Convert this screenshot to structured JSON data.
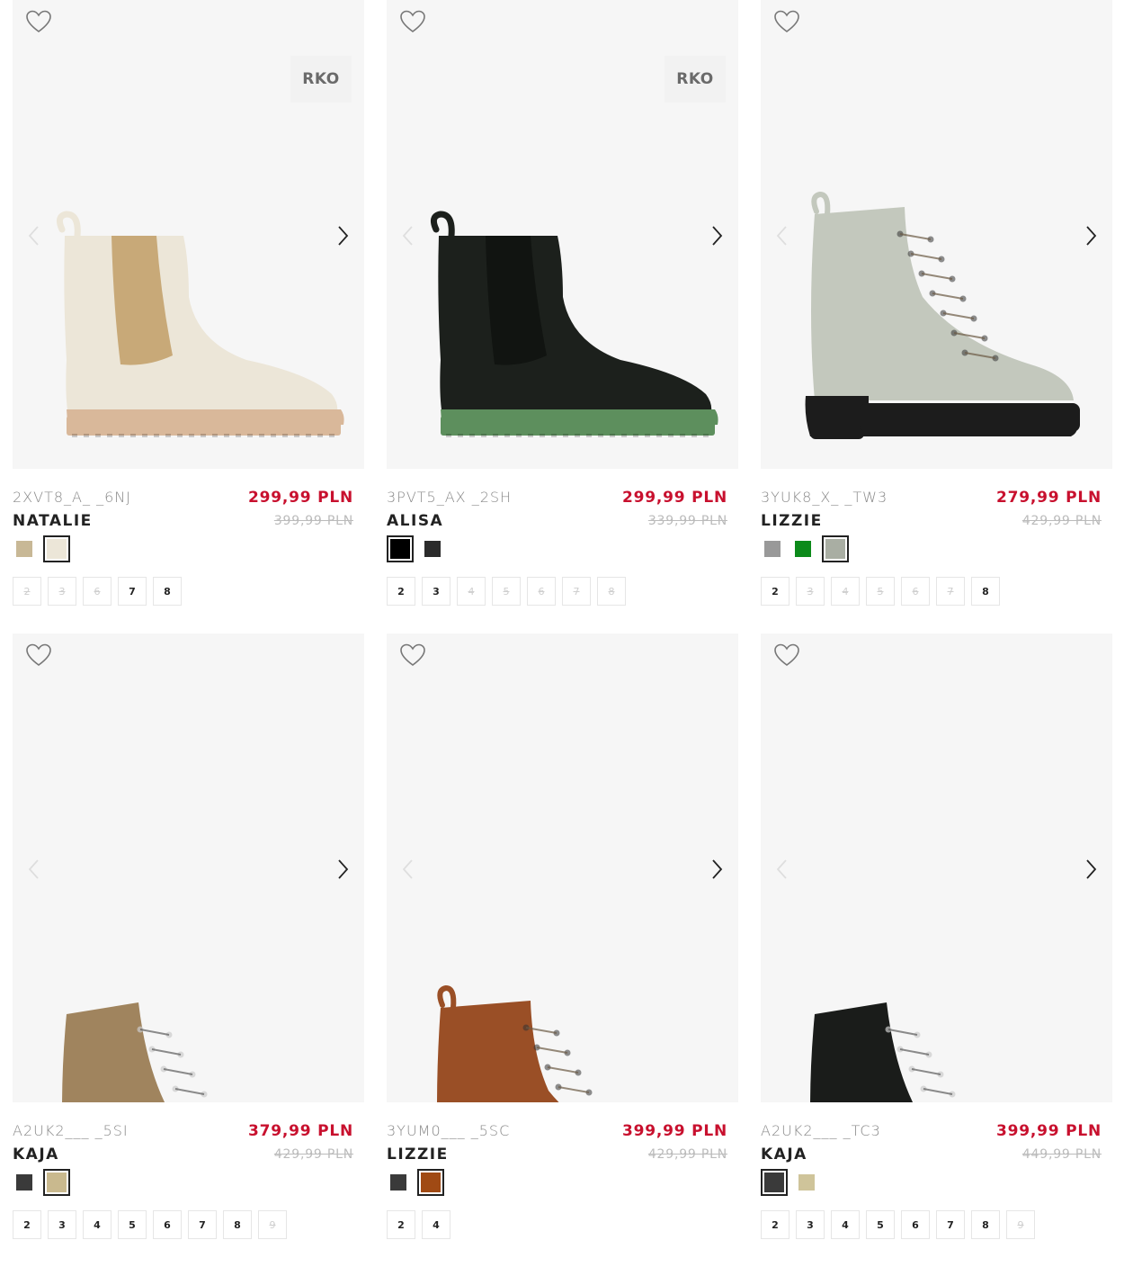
{
  "products": [
    {
      "code": "2XVT8_A_ _6NJ",
      "name": "NATALIE",
      "price": "299,99 PLN",
      "old_price": "399,99 PLN",
      "badge": "RKO",
      "colors": [
        "#c8b896",
        "#ece6d8"
      ],
      "active_color": 1,
      "sizes": [
        {
          "label": "2",
          "available": false
        },
        {
          "label": "3",
          "available": false
        },
        {
          "label": "6",
          "available": false
        },
        {
          "label": "7",
          "available": true
        },
        {
          "label": "8",
          "available": true
        }
      ],
      "boot": {
        "style": "chelsea",
        "upper": "#ece6d8",
        "elastic": "#c8a978",
        "sole": "#d9b89a"
      }
    },
    {
      "code": "3PVT5_AX _2SH",
      "name": "ALISA",
      "price": "299,99 PLN",
      "old_price": "339,99 PLN",
      "badge": "RKO",
      "colors": [
        "#000000",
        "#2b2b2b"
      ],
      "active_color": 0,
      "sizes": [
        {
          "label": "2",
          "available": true
        },
        {
          "label": "3",
          "available": true
        },
        {
          "label": "4",
          "available": false
        },
        {
          "label": "5",
          "available": false
        },
        {
          "label": "6",
          "available": false
        },
        {
          "label": "7",
          "available": false
        },
        {
          "label": "8",
          "available": false
        }
      ],
      "boot": {
        "style": "chelsea",
        "upper": "#1c201c",
        "elastic": "#111411",
        "sole": "#5d8f5d"
      }
    },
    {
      "code": "3YUK8_X_ _TW3",
      "name": "LIZZIE",
      "price": "279,99 PLN",
      "old_price": "429,99 PLN",
      "badge": "",
      "colors": [
        "#999999",
        "#0c8a1a",
        "#a9aea3"
      ],
      "active_color": 2,
      "sizes": [
        {
          "label": "2",
          "available": true
        },
        {
          "label": "3",
          "available": false
        },
        {
          "label": "4",
          "available": false
        },
        {
          "label": "5",
          "available": false
        },
        {
          "label": "6",
          "available": false
        },
        {
          "label": "7",
          "available": false
        },
        {
          "label": "8",
          "available": true
        }
      ],
      "boot": {
        "style": "lace",
        "upper": "#c3c8bd",
        "elastic": "#c3c8bd",
        "sole": "#1c1c1c"
      }
    },
    {
      "code": "A2UK2___ _5SI",
      "name": "KAJA",
      "price": "379,99 PLN",
      "old_price": "429,99 PLN",
      "badge": "",
      "colors": [
        "#3a3a3a",
        "#c9b98e"
      ],
      "active_color": 1,
      "sizes": [
        {
          "label": "2",
          "available": true
        },
        {
          "label": "3",
          "available": true
        },
        {
          "label": "4",
          "available": true
        },
        {
          "label": "5",
          "available": true
        },
        {
          "label": "6",
          "available": true
        },
        {
          "label": "7",
          "available": true
        },
        {
          "label": "8",
          "available": true
        },
        {
          "label": "9",
          "available": false
        }
      ],
      "boot": {
        "style": "chain",
        "upper": "#a0845e",
        "elastic": "#a0845e",
        "sole": "#1c1c1c"
      }
    },
    {
      "code": "3YUM0___ _5SC",
      "name": "LIZZIE",
      "price": "399,99 PLN",
      "old_price": "429,99 PLN",
      "badge": "",
      "colors": [
        "#3a3a3a",
        "#a04a14"
      ],
      "active_color": 1,
      "sizes": [
        {
          "label": "2",
          "available": true
        },
        {
          "label": "4",
          "available": true
        }
      ],
      "boot": {
        "style": "lace",
        "upper": "#9a4f26",
        "elastic": "#9a4f26",
        "sole": "#1c1c1c"
      }
    },
    {
      "code": "A2UK2___ _TC3",
      "name": "KAJA",
      "price": "399,99 PLN",
      "old_price": "449,99 PLN",
      "badge": "",
      "colors": [
        "#3a3a3a",
        "#cfc49a"
      ],
      "active_color": 0,
      "sizes": [
        {
          "label": "2",
          "available": true
        },
        {
          "label": "3",
          "available": true
        },
        {
          "label": "4",
          "available": true
        },
        {
          "label": "5",
          "available": true
        },
        {
          "label": "6",
          "available": true
        },
        {
          "label": "7",
          "available": true
        },
        {
          "label": "8",
          "available": true
        },
        {
          "label": "9",
          "available": false
        }
      ],
      "boot": {
        "style": "chain",
        "upper": "#1a1c1a",
        "elastic": "#1a1c1a",
        "sole": "#111111"
      }
    }
  ]
}
